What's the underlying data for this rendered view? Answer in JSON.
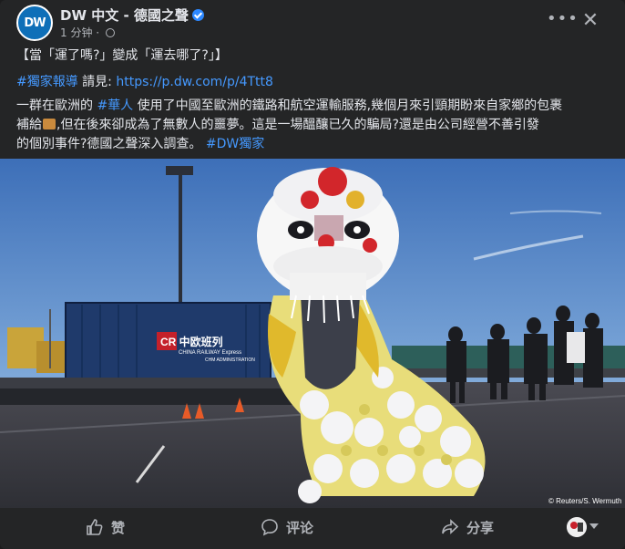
{
  "header": {
    "avatar_text": "DW",
    "page_name": "DW 中文 - 德國之聲",
    "time": "1 分钟 · "
  },
  "post": {
    "line1": "【當「運了嗎?」變成「運去哪了?」】",
    "tag1": "#獨家報導",
    "see": " 請見: ",
    "url": "https://p.dw.com/p/4Ttt8",
    "body_a": "一群在歐洲的 ",
    "tag2": "#華人",
    "body_b": " 使用了中國至歐洲的鐵路和航空運輸服務,幾個月來引頸期盼來自家鄉的包裹",
    "body_c": "補給",
    "body_d": ",但在後來卻成為了無數人的噩夢。這是一場醞釀已久的騙局?還是由公司經營不善引發",
    "body_e": "的個別事件?德國之聲深入調查。 ",
    "tag3": "#DW獨家"
  },
  "photo": {
    "credit": "© Reuters/S. Wermuth",
    "container_brand": "CR 中欧班列",
    "container_sub": "CHINA RAILWAY Express",
    "container_small": "CHM ADMINISTRATION"
  },
  "actions": {
    "like": "赞",
    "comment": "评论",
    "share": "分享"
  },
  "colors": {
    "bg": "#242526",
    "link": "#4599ff",
    "text": "#e4e6eb",
    "muted": "#b0b3b8"
  }
}
